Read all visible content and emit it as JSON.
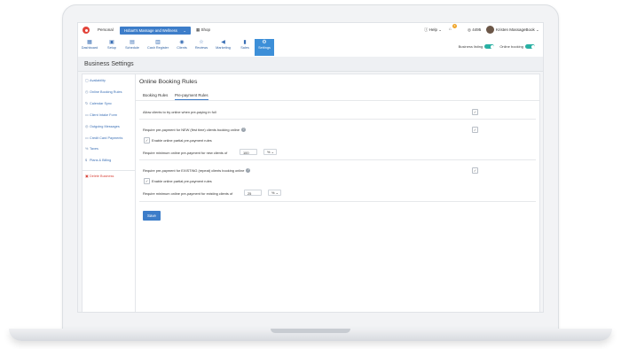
{
  "topbar": {
    "personal": "Personal",
    "business_select": "Hobart's Massage and Wellness",
    "business_chevron": "⌄",
    "shop": "Shop",
    "help": "Help ⌄",
    "notification_count": "3",
    "credits": "4495",
    "user": "Kristen MassageBook ⌄"
  },
  "nav": [
    {
      "label": "Dashboard",
      "icon": "▦"
    },
    {
      "label": "Setup",
      "icon": "▣"
    },
    {
      "label": "Schedule",
      "icon": "▤"
    },
    {
      "label": "Cash Register",
      "icon": "▥"
    },
    {
      "label": "Clients",
      "icon": "◉"
    },
    {
      "label": "Reviews",
      "icon": "☆"
    },
    {
      "label": "Marketing",
      "icon": "◀"
    },
    {
      "label": "Sales",
      "icon": "▮"
    },
    {
      "label": "Settings",
      "icon": "⚙"
    }
  ],
  "toggles": {
    "business_listing": "Business listing",
    "online_booking": "Online booking"
  },
  "page_title": "Business Settings",
  "sidebar": [
    {
      "label": "Availability",
      "icon": "▢"
    },
    {
      "label": "Online Booking Rules",
      "icon": "◷"
    },
    {
      "label": "Calendar Sync",
      "icon": "↻"
    },
    {
      "label": "Client Intake Form",
      "icon": "▭"
    },
    {
      "label": "Outgoing Messages",
      "icon": "◎"
    },
    {
      "label": "Credit Card Payments",
      "icon": "▭"
    },
    {
      "label": "Taxes",
      "icon": "%"
    },
    {
      "label": "Plans & Billing",
      "icon": "$"
    },
    {
      "label": "Delete Business",
      "icon": "▣"
    }
  ],
  "main": {
    "title": "Online Booking Rules",
    "tabs": [
      "Booking Rules",
      "Pre-payment Rules"
    ],
    "allow_prepaying": "Allow clients to try online when pre-paying in full",
    "require_new": "Require pre-payment for NEW (first time) clients booking online",
    "enable_partial_new": "Enable online partial pre-payment rules",
    "min_new": "Require minimum online pre-payment for new clients of",
    "min_new_value": "100",
    "unit_new": "%",
    "require_existing": "Require pre-payment for EXISTING (repeat) clients booking online",
    "enable_partial_existing": "Enable online partial pre-payment rules",
    "min_existing": "Require minimum online pre-payment for existing clients of",
    "min_existing_value": "25",
    "unit_existing": "%",
    "select_chevron": "⌄",
    "save": "Save",
    "check": "✓",
    "info": "?"
  }
}
